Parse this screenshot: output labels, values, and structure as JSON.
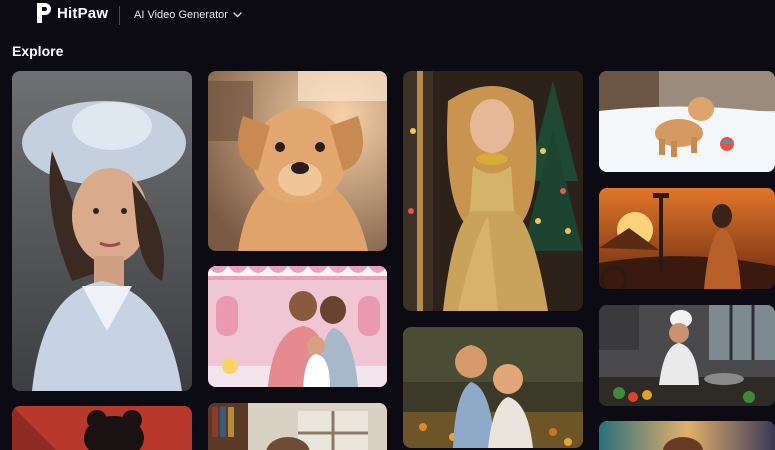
{
  "header": {
    "brand": "HitPaw",
    "product": "AI Video Generator"
  },
  "explore": {
    "title": "Explore"
  },
  "icons": {
    "logo": "hitpaw-logo-icon",
    "dropdown": "chevron-down-icon"
  },
  "colors": {
    "background": "#0c0a12",
    "text": "#ffffff"
  }
}
